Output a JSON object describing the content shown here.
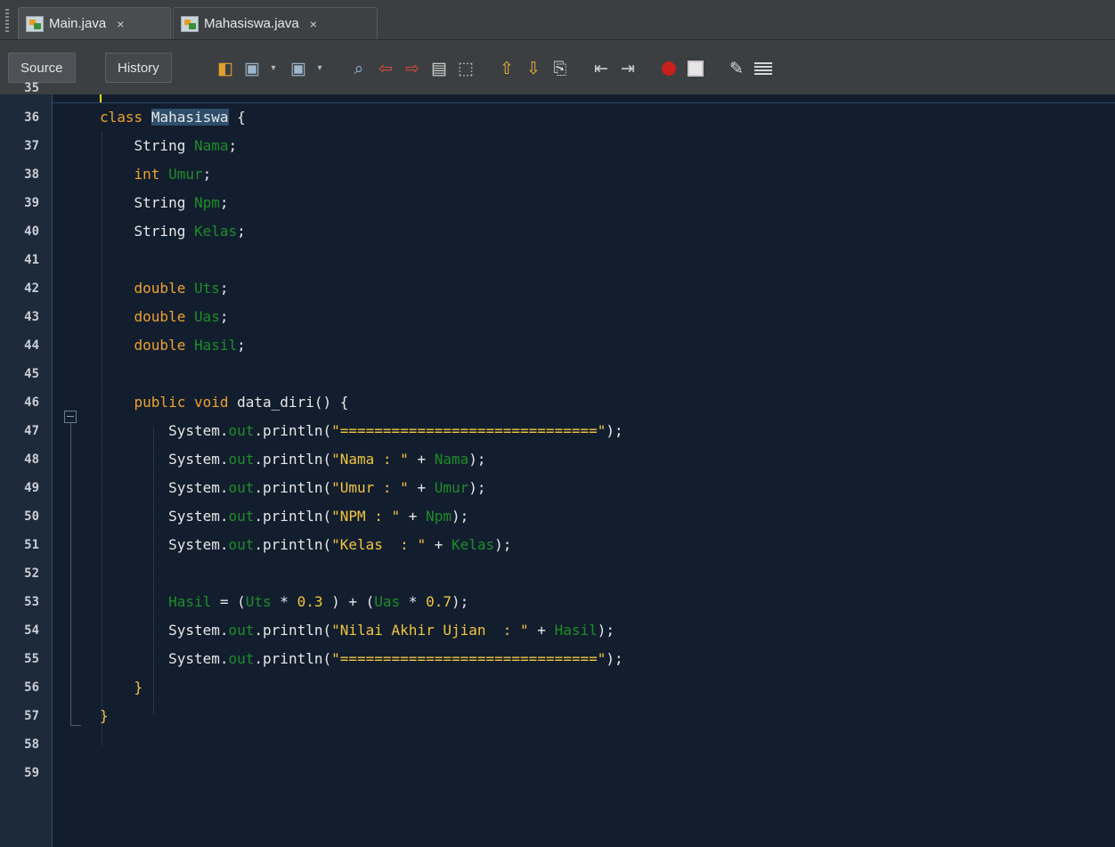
{
  "tabs": [
    {
      "label": "Main.java",
      "close": "×"
    },
    {
      "label": "Mahasiswa.java",
      "close": "×"
    }
  ],
  "toolbar": {
    "source_label": "Source",
    "history_label": "History",
    "icons": [
      "last-edit-icon",
      "back-icon",
      "forward-icon",
      "find-selection-icon",
      "find-previous-icon",
      "find-next-icon",
      "toggle-highlight-icon",
      "toggle-rectangular-selection-icon",
      "previous-bookmark-icon",
      "next-bookmark-icon",
      "toggle-bookmark-icon",
      "shift-left-icon",
      "shift-right-icon",
      "start-macro-recording-icon",
      "stop-macro-recording-icon",
      "comment-icon",
      "uncomment-icon"
    ]
  },
  "editor": {
    "partial_first_line": "35",
    "line_numbers": [
      "36",
      "37",
      "38",
      "39",
      "40",
      "41",
      "42",
      "43",
      "44",
      "45",
      "46",
      "47",
      "48",
      "49",
      "50",
      "51",
      "52",
      "53",
      "54",
      "55",
      "56",
      "57",
      "58",
      "59"
    ]
  },
  "code": {
    "l36": {
      "kw": "class",
      "name": "Mahasiswa",
      "rest": " {"
    },
    "l37": {
      "type": "String",
      "field": "Nama",
      "end": ";"
    },
    "l38": {
      "type": "int",
      "field": "Umur",
      "end": ";"
    },
    "l39": {
      "type": "String",
      "field": "Npm",
      "end": ";"
    },
    "l40": {
      "type": "String",
      "field": "Kelas",
      "end": ";"
    },
    "l42": {
      "type": "double",
      "field": "Uts",
      "end": ";"
    },
    "l43": {
      "type": "double",
      "field": "Uas",
      "end": ";"
    },
    "l44": {
      "type": "double",
      "field": "Hasil",
      "end": ";"
    },
    "l46": {
      "kw": "public void",
      "rest": " data_diri() {"
    },
    "l47": {
      "a": "System.",
      "out": "out",
      "b": ".println(",
      "str": "\"==============================\"",
      "c": ");"
    },
    "l48": {
      "a": "System.",
      "out": "out",
      "b": ".println(",
      "str": "\"Nama : \"",
      "plus": " + ",
      "field": "Nama",
      "c": ");"
    },
    "l49": {
      "a": "System.",
      "out": "out",
      "b": ".println(",
      "str": "\"Umur : \"",
      "plus": " + ",
      "field": "Umur",
      "c": ");"
    },
    "l50": {
      "a": "System.",
      "out": "out",
      "b": ".println(",
      "str": "\"NPM : \"",
      "plus": " + ",
      "field": "Npm",
      "c": ");"
    },
    "l51": {
      "a": "System.",
      "out": "out",
      "b": ".println(",
      "str": "\"Kelas  : \"",
      "plus": " + ",
      "field": "Kelas",
      "c": ");"
    },
    "l53": {
      "f1": "Hasil",
      "p1": " = (",
      "f2": "Uts",
      "p2": " * ",
      "n1": "0.3",
      "p3": " ) + (",
      "f3": "Uas",
      "p4": " * ",
      "n2": "0.7",
      "p5": ");"
    },
    "l54": {
      "a": "System.",
      "out": "out",
      "b": ".println(",
      "str": "\"Nilai Akhir Ujian  : \"",
      "plus": " + ",
      "field": "Hasil",
      "c": ");"
    },
    "l55": {
      "a": "System.",
      "out": "out",
      "b": ".println(",
      "str": "\"==============================\"",
      "c": ");"
    },
    "l56": {
      "brace": "}"
    },
    "l57": {
      "brace": "}"
    }
  },
  "colors": {
    "editor_bg": "#121e2e",
    "keyword": "#f0a030",
    "field": "#1e8c2a",
    "string": "#f2c53e",
    "text": "#e8e8e8",
    "selection": "#2f4e6b"
  }
}
